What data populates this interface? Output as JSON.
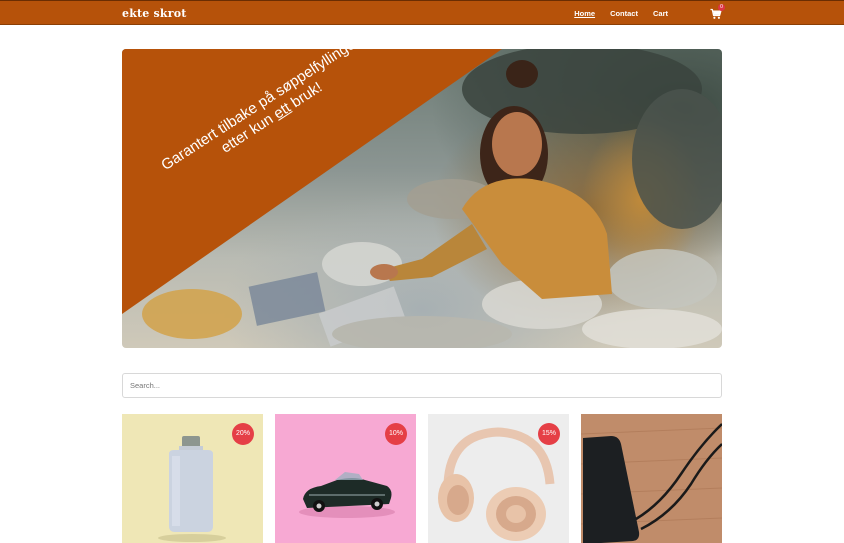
{
  "nav": {
    "brand": "ekte skrot",
    "links": [
      {
        "label": "Home",
        "active": true
      },
      {
        "label": "Contact",
        "active": false
      },
      {
        "label": "Cart",
        "active": false
      }
    ],
    "cart_icon": "shopping-cart-icon",
    "cart_count": "0"
  },
  "hero": {
    "line1": "Garantert tilbake på søppelfyllingen",
    "line2_pre": "etter kun ",
    "line2_underlined": "ett",
    "line2_post": " bruk!"
  },
  "search": {
    "placeholder": "Search..."
  },
  "products": [
    {
      "image": "perfume-bottle",
      "discount": "20%"
    },
    {
      "image": "toy-car",
      "discount": "10%"
    },
    {
      "image": "headphones",
      "discount": "15%"
    },
    {
      "image": "external-hard-drive",
      "discount": ""
    }
  ],
  "colors": {
    "primary": "#b6520a",
    "badge": "#e53f46"
  }
}
